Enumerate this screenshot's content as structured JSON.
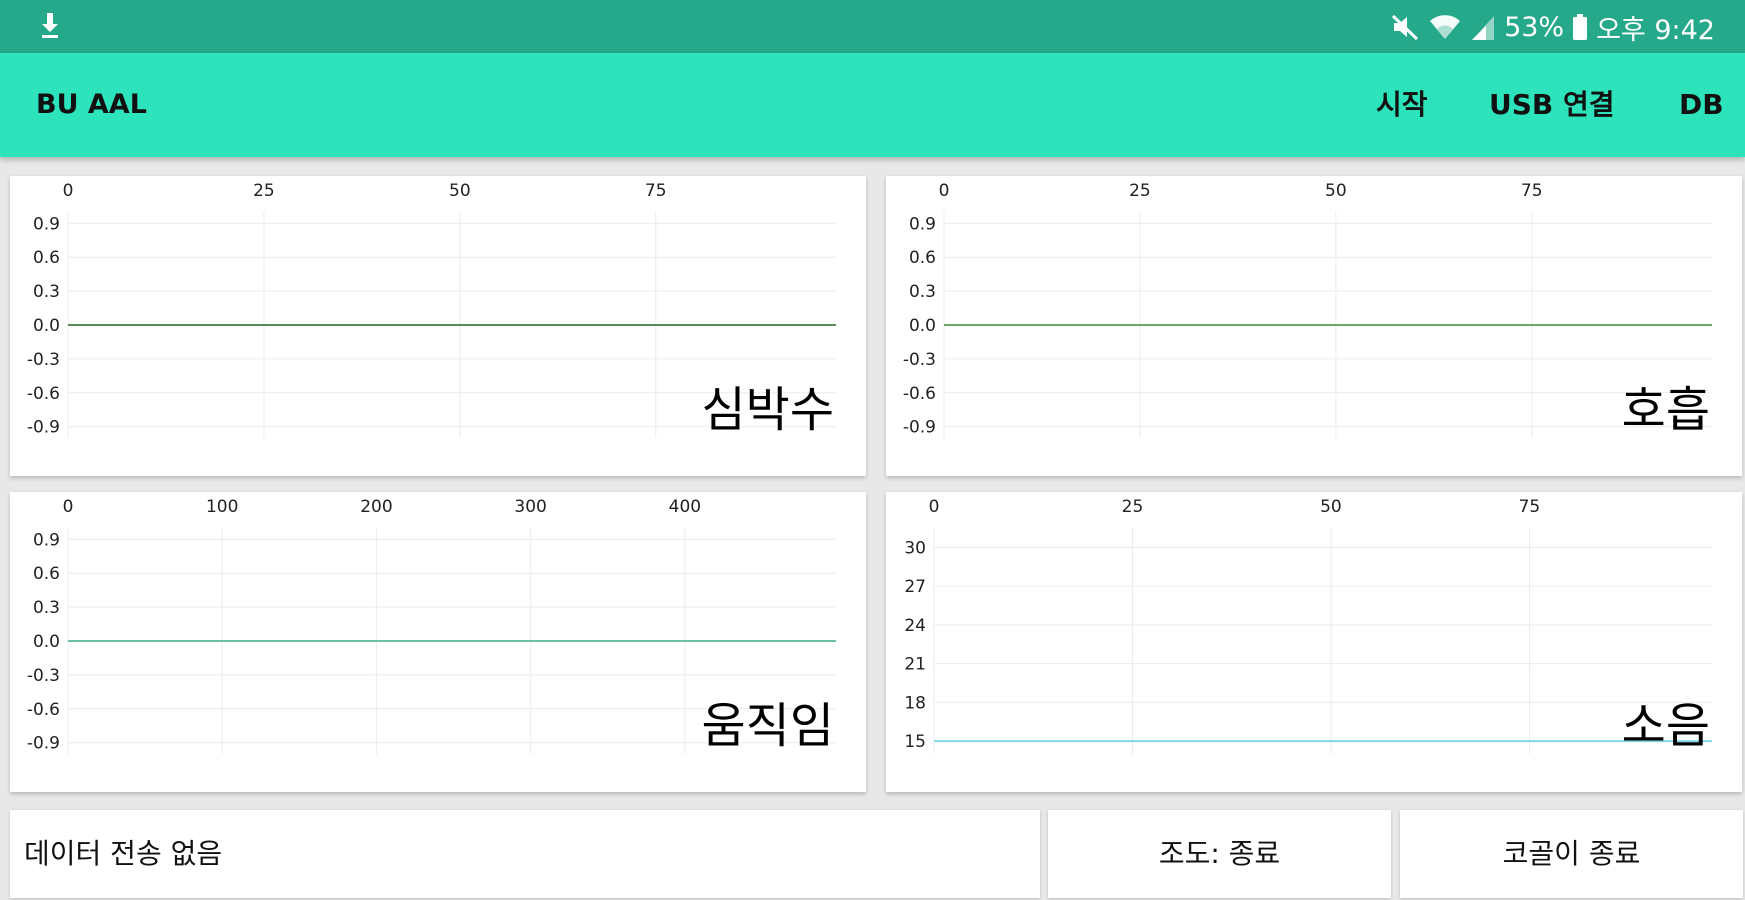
{
  "status_bar": {
    "battery": "53%",
    "time": "오후 9:42",
    "icons": [
      "download-icon",
      "mute-icon",
      "wifi-icon",
      "signal-icon",
      "battery-icon"
    ]
  },
  "app_bar": {
    "title": "BU AAL",
    "actions": [
      {
        "label": "시작"
      },
      {
        "label": "USB 연결"
      },
      {
        "label": "DB"
      }
    ],
    "color": "#2de3bb"
  },
  "charts": [
    {
      "title": "심박수",
      "x_ticks": [
        "0",
        "25",
        "50",
        "75"
      ],
      "y_ticks": [
        "0.9",
        "0.6",
        "0.3",
        "0.0",
        "-0.3",
        "-0.6",
        "-0.9"
      ]
    },
    {
      "title": "호흡",
      "x_ticks": [
        "0",
        "25",
        "50",
        "75"
      ],
      "y_ticks": [
        "0.9",
        "0.6",
        "0.3",
        "0.0",
        "-0.3",
        "-0.6",
        "-0.9"
      ]
    },
    {
      "title": "움직임",
      "x_ticks": [
        "0",
        "100",
        "200",
        "300",
        "400"
      ],
      "y_ticks": [
        "0.9",
        "0.6",
        "0.3",
        "0.0",
        "-0.3",
        "-0.6",
        "-0.9"
      ]
    },
    {
      "title": "소음",
      "x_ticks": [
        "0",
        "25",
        "50",
        "75"
      ],
      "y_ticks": [
        "30",
        "27",
        "24",
        "21",
        "18",
        "15"
      ]
    }
  ],
  "chart_data": [
    {
      "type": "line",
      "title": "심박수",
      "x_ticks": [
        0,
        25,
        50,
        75
      ],
      "xlim": [
        0,
        98
      ],
      "ylim": [
        -1.0,
        1.0
      ],
      "y_ticks": [
        0.9,
        0.6,
        0.3,
        0.0,
        -0.3,
        -0.6,
        -0.9
      ],
      "series": [
        {
          "x": [
            0,
            98
          ],
          "y": [
            0,
            0
          ],
          "color": "#5a8a5a"
        }
      ],
      "grid": true
    },
    {
      "type": "line",
      "title": "호흡",
      "x_ticks": [
        0,
        25,
        50,
        75
      ],
      "xlim": [
        0,
        98
      ],
      "ylim": [
        -1.0,
        1.0
      ],
      "y_ticks": [
        0.9,
        0.6,
        0.3,
        0.0,
        -0.3,
        -0.6,
        -0.9
      ],
      "series": [
        {
          "x": [
            0,
            98
          ],
          "y": [
            0,
            0
          ],
          "color": "#6aaa6a"
        }
      ],
      "grid": true
    },
    {
      "type": "line",
      "title": "움직임",
      "x_ticks": [
        0,
        100,
        200,
        300,
        400
      ],
      "xlim": [
        0,
        498
      ],
      "ylim": [
        -1.0,
        1.0
      ],
      "y_ticks": [
        0.9,
        0.6,
        0.3,
        0.0,
        -0.3,
        -0.6,
        -0.9
      ],
      "series": [
        {
          "x": [
            0,
            498
          ],
          "y": [
            0,
            0
          ],
          "color": "#6ac0a0"
        }
      ],
      "grid": true
    },
    {
      "type": "line",
      "title": "소음",
      "x_ticks": [
        0,
        25,
        50,
        75
      ],
      "xlim": [
        0,
        98
      ],
      "ylim": [
        14,
        31.5
      ],
      "y_ticks": [
        30,
        27,
        24,
        21,
        18,
        15
      ],
      "series": [
        {
          "x": [
            0,
            98
          ],
          "y": [
            15,
            15
          ],
          "color": "#7fd9e8"
        }
      ],
      "grid": true
    }
  ],
  "footer": {
    "status_text": "데이터 전송 없음",
    "illuminance_button": "조도: 종료",
    "snoring_button": "코골이 종료"
  }
}
